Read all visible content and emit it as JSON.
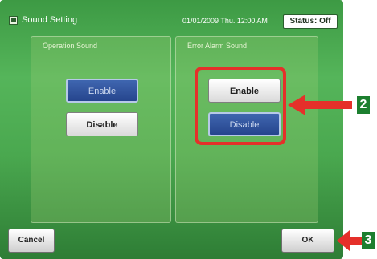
{
  "window": {
    "title": "Sound Setting",
    "datetime": "01/01/2009 Thu. 12:00 AM",
    "status": "Status: Off",
    "title_icon": "panel-icon"
  },
  "operation_sound": {
    "label": "Operation Sound",
    "enable_label": "Enable",
    "disable_label": "Disable",
    "selected": "Enable"
  },
  "error_alarm_sound": {
    "label": "Error Alarm Sound",
    "enable_label": "Enable",
    "disable_label": "Disable",
    "selected": "Disable"
  },
  "footer": {
    "cancel_label": "Cancel",
    "ok_label": "OK"
  },
  "callouts": {
    "step_2": "2",
    "step_3": "3",
    "color": "#e5302a",
    "badge_color": "#1c7f2f"
  }
}
